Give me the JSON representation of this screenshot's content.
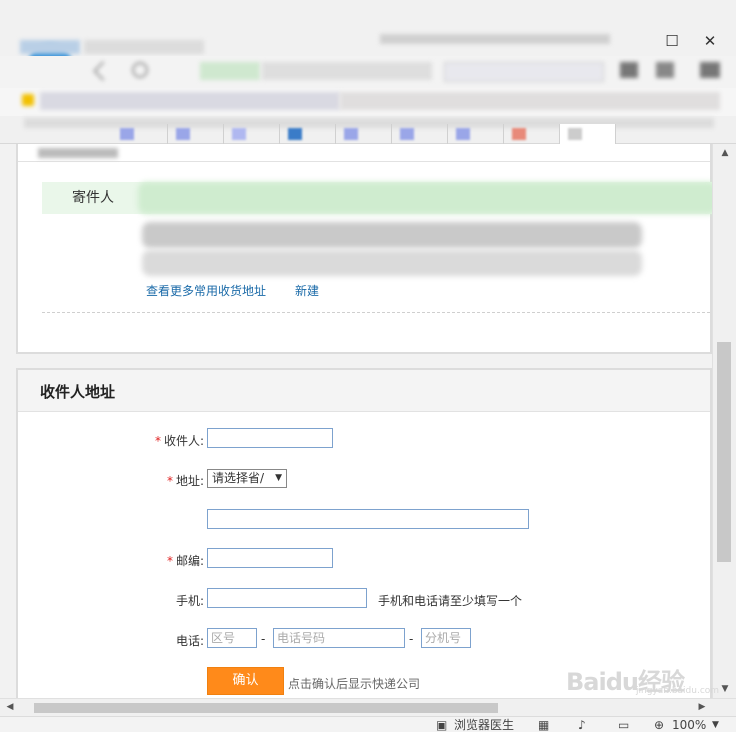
{
  "sender_section": {
    "sender_label": "寄件人",
    "more_addresses_link": "查看更多常用收货地址",
    "new_link": "新建"
  },
  "recipient_section": {
    "title": "收件人地址",
    "required_mark": "*",
    "recipient_label": "收件人:",
    "address_label": "地址:",
    "province_select": "请选择省/",
    "postcode_label": "邮编:",
    "mobile_label": "手机:",
    "mobile_hint": "手机和电话请至少填写一个",
    "phone_label": "电话:",
    "area_code_placeholder": "区号",
    "phone_number_placeholder": "电话号码",
    "extension_placeholder": "分机号",
    "dash": "-",
    "confirm_button": "确认",
    "confirm_hint": "点击确认后显示快递公司"
  },
  "status_bar": {
    "doctor": "浏览器医生",
    "zoom": "100%"
  },
  "watermark": {
    "text": "Baidu经验",
    "sub": "jingyan.baidu.com"
  },
  "colors": {
    "accent_orange": "#ff8a1a",
    "link_blue": "#1a6aa8",
    "required_red": "#e02020",
    "sender_row_green": "#eaf7ea"
  }
}
